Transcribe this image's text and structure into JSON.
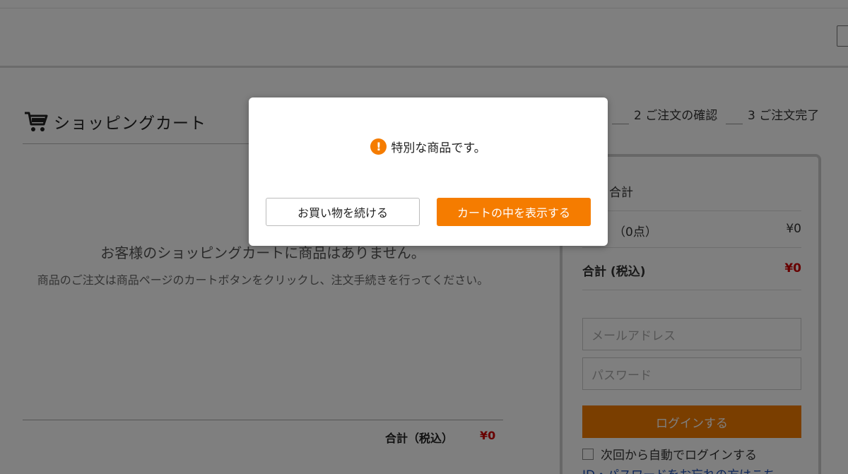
{
  "cart": {
    "title": "ショッピングカート",
    "empty_message": "お客様のショッピングカートに商品はありません。",
    "empty_hint": "商品のご注文は商品ページのカートボタンをクリックし、注文手続きを行ってください。",
    "total_label": "合計（税込）",
    "total_value": "¥0"
  },
  "steps": [
    {
      "label": "2 ご注文の確認"
    },
    {
      "label": "3 ご注文完了"
    }
  ],
  "summary": {
    "title": "合計",
    "subtotal_label": "（0点）",
    "subtotal_value": "¥0",
    "total_label": "合計 (税込)",
    "total_value": "¥0",
    "email_placeholder": "メールアドレス",
    "password_placeholder": "パスワード",
    "login_button": "ログインする",
    "auto_login_label": "次回から自動でログインする",
    "forgot_link": "ID・パスワードをお忘れの方はこち"
  },
  "modal": {
    "message": "特別な商品です。",
    "continue_button": "お買い物を続ける",
    "view_cart_button": "カートの中を表示する"
  },
  "colors": {
    "accent": "#f57c00",
    "price_red": "#d00000",
    "overlay": "rgba(0,0,0,0.5)"
  }
}
